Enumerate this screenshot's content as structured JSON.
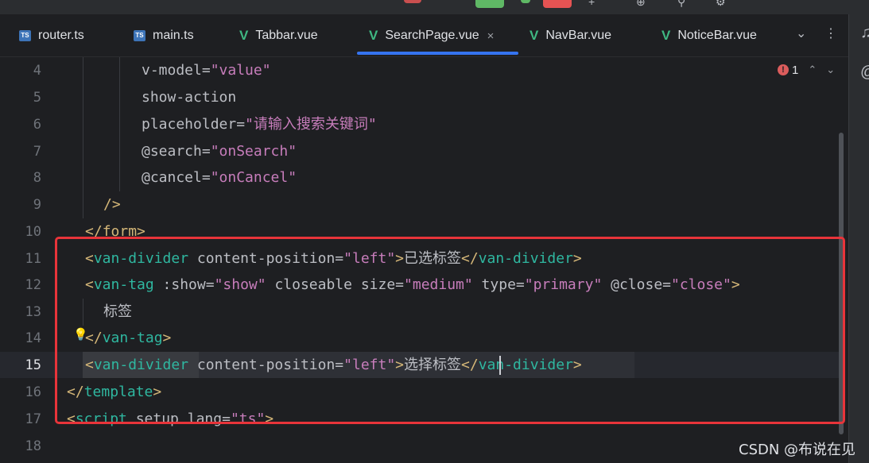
{
  "tabs": [
    {
      "name": "router.ts",
      "icon": "ts-file-icon",
      "active": false
    },
    {
      "name": "main.ts",
      "icon": "ts-file-icon",
      "active": false
    },
    {
      "name": "Tabbar.vue",
      "icon": "vue-file-icon",
      "active": false
    },
    {
      "name": "SearchPage.vue",
      "icon": "vue-file-icon",
      "active": true,
      "close": "×"
    },
    {
      "name": "NavBar.vue",
      "icon": "vue-file-icon",
      "active": false
    },
    {
      "name": "NoticeBar.vue",
      "icon": "vue-file-icon",
      "active": false
    }
  ],
  "tab_tools": {
    "more_tabs": "⌄",
    "menu": "⋮"
  },
  "inspection": {
    "error_mark": "!",
    "count": "1",
    "prev": "⌃",
    "next": "⌄"
  },
  "line_numbers": [
    "4",
    "5",
    "6",
    "7",
    "8",
    "9",
    "10",
    "11",
    "12",
    "13",
    "14",
    "15",
    "16",
    "17",
    "18"
  ],
  "current_line": "15",
  "code": {
    "l4": {
      "attr": "v-model",
      "eq": "=",
      "val": "\"value\""
    },
    "l5": {
      "attr": "show-action"
    },
    "l6": {
      "attr": "placeholder",
      "eq": "=",
      "val": "\"请输入搜索关键词\""
    },
    "l7": {
      "attr": "@search",
      "eq": "=",
      "val": "\"onSearch\""
    },
    "l8": {
      "attr": "@cancel",
      "eq": "=",
      "val": "\"onCancel\""
    },
    "l9": {
      "close": "/>"
    },
    "l10": {
      "open": "</",
      "tag": "form",
      "close": ">"
    },
    "l11": {
      "open": "<",
      "tag": "van-divider",
      "attr": " content-position",
      "eq": "=",
      "val": "\"left\"",
      "gt": ">",
      "text": "已选标签",
      "copen": "</",
      "ctag": "van-divider",
      "cclose": ">"
    },
    "l12": {
      "open": "<",
      "tag": "van-tag",
      "a1": " :show",
      "e1": "=",
      "v1": "\"show\"",
      "a2": " closeable size",
      "e2": "=",
      "v2": "\"medium\"",
      "a3": " type",
      "e3": "=",
      "v3": "\"primary\"",
      "a4": " @close",
      "e4": "=",
      "v4": "\"close\"",
      "gt": ">"
    },
    "l13": {
      "text": "标签"
    },
    "l14": {
      "open": "</",
      "tag": "van-tag",
      "close": ">"
    },
    "l15": {
      "open": "<",
      "tag": "van-divider",
      "attr": " content-position",
      "eq": "=",
      "val": "\"left\"",
      "gt": ">",
      "text": "选择标签",
      "copen": "</",
      "ctag": "van-divider",
      "cclose": ">"
    },
    "l16": {
      "open": "</",
      "tag": "template",
      "close": ">"
    },
    "l17": {
      "open": "<",
      "tag": "script",
      "attr": " setup lang",
      "eq": "=",
      "val": "\"ts\"",
      "gt": ">"
    }
  },
  "watermark": "CSDN @布说在见",
  "colors": {
    "background": "#1e1f22",
    "tag": "#2fb7a0",
    "string": "#c77dbb",
    "bracket": "#d5b778",
    "highlight_box": "#e8343a",
    "active_tab_underline": "#3574f0"
  }
}
